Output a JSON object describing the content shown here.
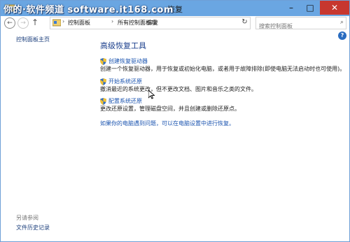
{
  "window": {
    "title": "恢复",
    "watermark": "你的·软件频道 software.it168.com"
  },
  "nav": {
    "breadcrumbs": [
      "控制面板",
      "所有控制面板项",
      "恢复"
    ],
    "search_placeholder": "搜索控制面板"
  },
  "left": {
    "home_link": "控制面板主页",
    "see_also": "另请参阅",
    "file_history": "文件历史记录"
  },
  "main": {
    "heading": "高级恢复工具",
    "tasks": [
      {
        "label": "创建恢复驱动器",
        "desc": "创建一个恢复驱动器，用于恢复或初始化电脑，或者用于故障排除(即使电脑无法启动时也可使用)。"
      },
      {
        "label": "开始系统还原",
        "desc": "撤消最近的系统更改，但不更改文档、图片和音乐之类的文件。"
      },
      {
        "label": "配置系统还原",
        "desc": "更改还原设置，管理磁盘空间，并且创建或删除还原点。"
      }
    ],
    "pc_settings_link": "如果你的电脑遇到问题，可以在电脑设置中进行恢复。"
  },
  "colors": {
    "titlebar": "#6aa6e2",
    "close": "#c7372f",
    "link": "#1c55b0",
    "heading": "#1b3f8c"
  }
}
